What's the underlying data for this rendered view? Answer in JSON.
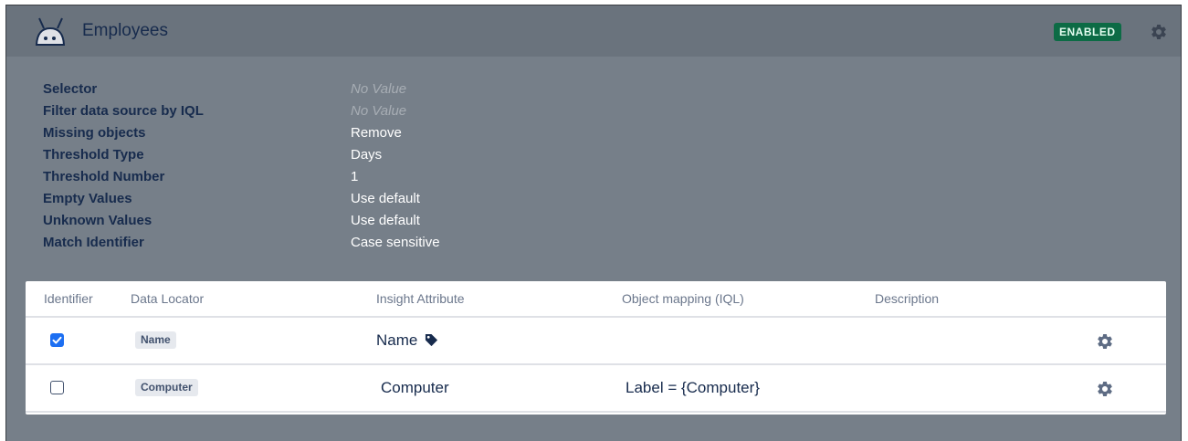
{
  "header": {
    "title": "Employees",
    "status_badge": "ENABLED",
    "icon": "robot-icon",
    "settings_icon": "gear-icon"
  },
  "properties": [
    {
      "label": "Selector",
      "value": "No Value",
      "empty": true
    },
    {
      "label": "Filter data source by IQL",
      "value": "No Value",
      "empty": true
    },
    {
      "label": "Missing objects",
      "value": "Remove",
      "empty": false
    },
    {
      "label": "Threshold Type",
      "value": "Days",
      "empty": false
    },
    {
      "label": "Threshold Number",
      "value": "1",
      "empty": false
    },
    {
      "label": "Empty Values",
      "value": "Use default",
      "empty": false
    },
    {
      "label": "Unknown Values",
      "value": "Use default",
      "empty": false
    },
    {
      "label": "Match Identifier",
      "value": "Case sensitive",
      "empty": false
    }
  ],
  "table": {
    "columns": [
      "Identifier",
      "Data Locator",
      "Insight Attribute",
      "Object mapping (IQL)",
      "Description"
    ],
    "rows": [
      {
        "identifier": true,
        "data_locator": "Name",
        "insight_attribute": "Name",
        "label_icon": "tag-icon",
        "object_mapping": "",
        "description": ""
      },
      {
        "identifier": false,
        "data_locator": "Computer",
        "insight_attribute": "Computer",
        "object_mapping": "Label = {Computer}",
        "description": ""
      }
    ]
  },
  "colors": {
    "panel_background": "#767f89",
    "header_background": "#6a737d",
    "badge_green": "#0c6b45",
    "checkbox_blue": "#1d6ff2"
  }
}
